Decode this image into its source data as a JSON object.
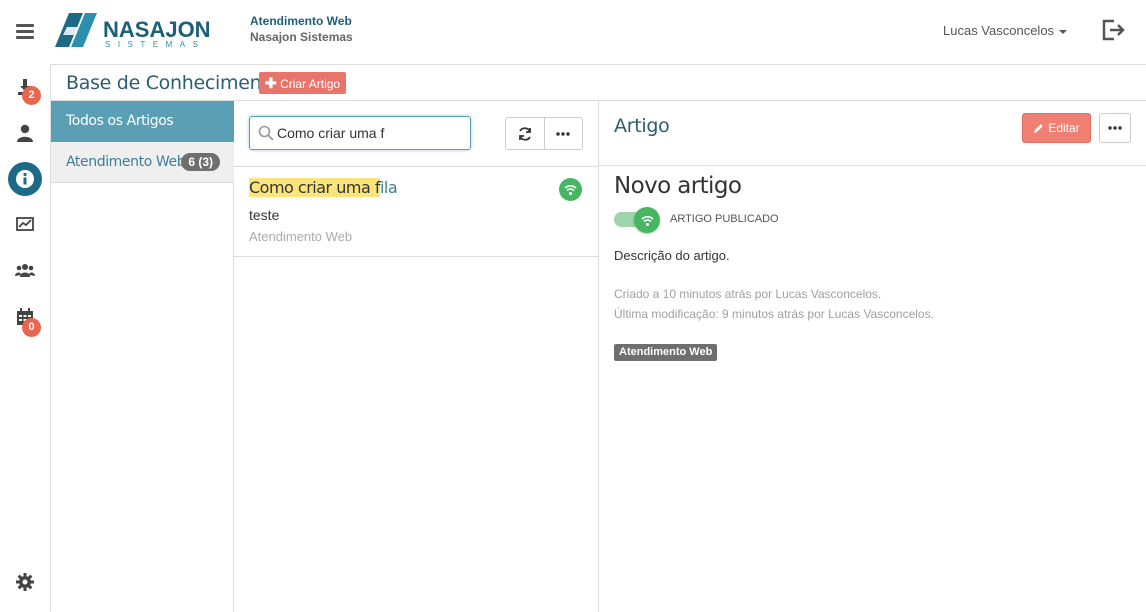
{
  "header": {
    "brand_name": "NASAJON",
    "brand_sub": "SISTEMAS",
    "app_title": "Atendimento Web",
    "company": "Nasajon Sistemas",
    "user_name": "Lucas Vasconcelos"
  },
  "sidebar": {
    "downloads_badge": "2",
    "calendar_badge": "0"
  },
  "page": {
    "title": "Base de Conhecimento",
    "create_button": "Criar Artigo"
  },
  "categories": [
    {
      "label": "Todos os Artigos"
    },
    {
      "label": "Atendimento Web",
      "count": "6 (3)"
    }
  ],
  "search": {
    "value": "Como criar uma f"
  },
  "article_list": [
    {
      "title_highlight": "Como criar uma f",
      "title_rest": "ila",
      "description": "teste",
      "category": "Atendimento Web"
    }
  ],
  "detail": {
    "heading": "Artigo",
    "edit_button": "Editar",
    "title": "Novo artigo",
    "status_label": "ARTIGO PUBLICADO",
    "description": "Descrição do artigo.",
    "created": "Criado a 10 minutos atrás por Lucas Vasconcelos.",
    "modified": "Última modificação: 9 minutos atrás por Lucas Vasconcelos.",
    "tag": "Atendimento Web"
  },
  "colors": {
    "accent": "#5b9fb4",
    "brand_dark": "#1d6a86",
    "create_button": "#e8756a",
    "published_green": "#46b662",
    "badge": "#e8664f"
  }
}
